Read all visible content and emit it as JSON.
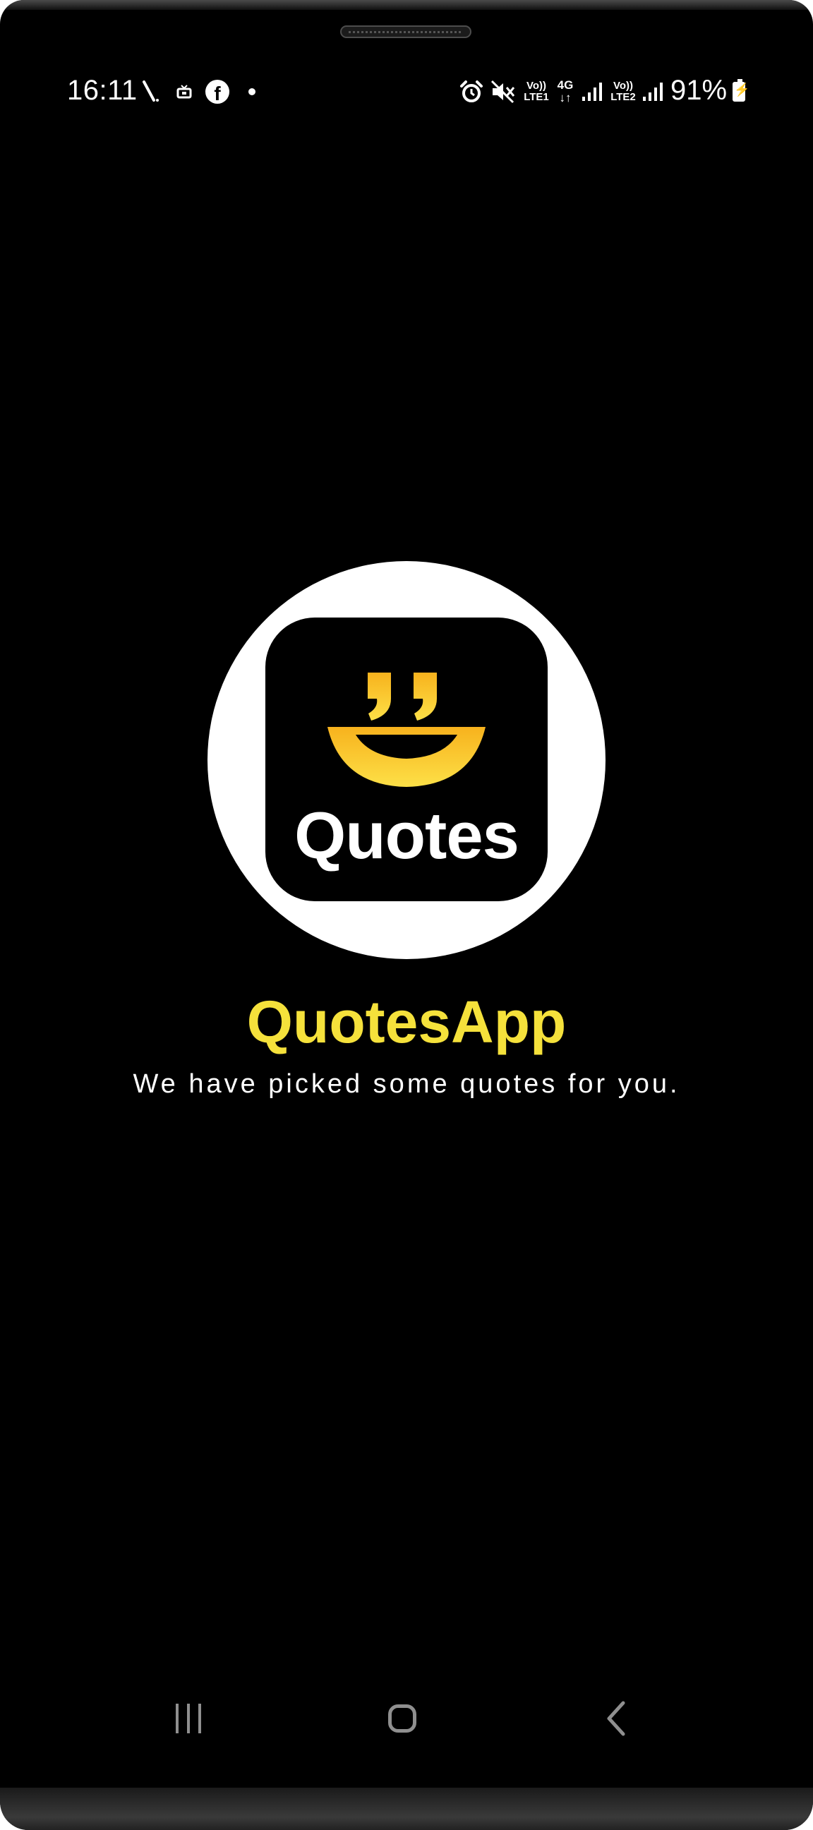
{
  "status_bar": {
    "time": "16:11",
    "battery": "91%",
    "sim1_label_top": "Vo))",
    "sim1_label_bottom": "LTE1",
    "sim2_label_top": "Vo))",
    "sim2_label_bottom": "LTE2",
    "network_type": "4G",
    "network_arrows": "↓↑",
    "facebook_glyph": "f",
    "icons": [
      "pen-icon",
      "cast-icon",
      "facebook-icon",
      "notification-dot-icon",
      "alarm-icon",
      "mute-icon",
      "signal-icon",
      "battery-charging-icon"
    ]
  },
  "splash": {
    "logo_word": "Quotes",
    "app_title": "QuotesApp",
    "tagline": "We have picked some quotes for you.",
    "accent_color": "#f5e13b",
    "logo_gradient": [
      "#f7b21d",
      "#fde047"
    ]
  },
  "nav_bar": {
    "icons": [
      "recents-icon",
      "home-icon",
      "back-icon"
    ]
  }
}
